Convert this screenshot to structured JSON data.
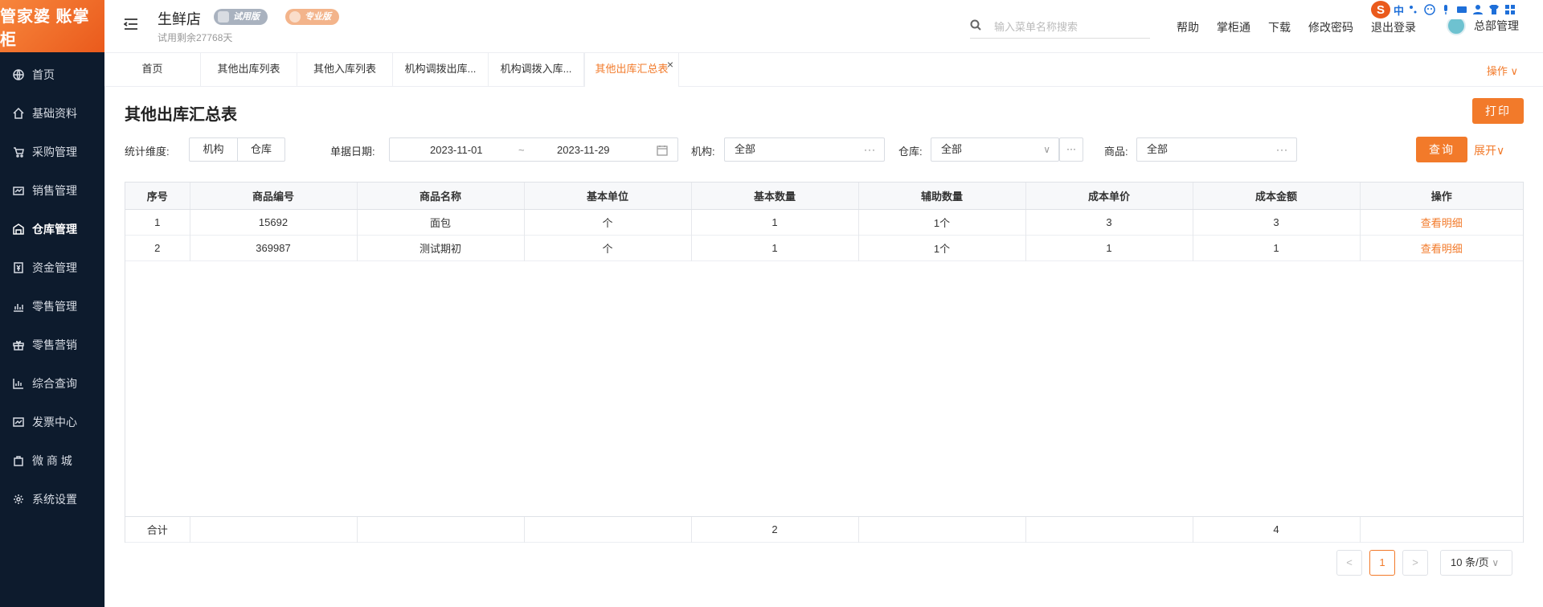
{
  "brand": {
    "logo_text": "管家婆 账掌柜"
  },
  "sidebar": {
    "items": [
      {
        "label": "首页",
        "icon": "globe-icon"
      },
      {
        "label": "基础资料",
        "icon": "home-icon"
      },
      {
        "label": "采购管理",
        "icon": "cart-icon"
      },
      {
        "label": "销售管理",
        "icon": "sales-icon"
      },
      {
        "label": "仓库管理",
        "icon": "warehouse-icon",
        "active": true
      },
      {
        "label": "资金管理",
        "icon": "money-icon"
      },
      {
        "label": "零售管理",
        "icon": "chart-icon"
      },
      {
        "label": "零售营销",
        "icon": "gift-icon"
      },
      {
        "label": "综合查询",
        "icon": "bar-chart-icon"
      },
      {
        "label": "发票中心",
        "icon": "invoice-icon"
      },
      {
        "label": "微 商 城",
        "icon": "bag-icon"
      },
      {
        "label": "系统设置",
        "icon": "gear-icon"
      }
    ]
  },
  "header": {
    "store_name": "生鲜店",
    "badge_trial": "试用版",
    "badge_pro": "专业版",
    "trial_days": "试用剩余27768天",
    "search_placeholder": "输入菜单名称搜索",
    "links": [
      "帮助",
      "掌柜通",
      "下载",
      "修改密码",
      "退出登录"
    ],
    "user_name": "总部管理",
    "ime_label": "中"
  },
  "tabs": {
    "items": [
      "首页",
      "其他出库列表",
      "其他入库列表",
      "机构调拨出库...",
      "机构调拨入库...",
      "其他出库汇总表"
    ],
    "close_glyph": "×",
    "ops_label": "操作 ∨"
  },
  "page": {
    "title": "其他出库汇总表",
    "print_label": "打印",
    "filters": {
      "dim_label": "统计维度:",
      "dim_options": [
        "机构",
        "仓库"
      ],
      "date_label": "单据日期:",
      "date_from": "2023-11-01",
      "date_sep": "~",
      "date_to": "2023-11-29",
      "org_label": "机构:",
      "org_value": "全部",
      "wh_label": "仓库:",
      "wh_value": "全部",
      "product_label": "商品:",
      "product_value": "全部",
      "more_glyph": "···",
      "query_label": "查询",
      "expand_label": "展开∨"
    }
  },
  "table": {
    "columns": [
      "序号",
      "商品编号",
      "商品名称",
      "基本单位",
      "基本数量",
      "辅助数量",
      "成本单价",
      "成本金额",
      "操作"
    ],
    "rows": [
      [
        "1",
        "15692",
        "面包",
        "个",
        "1",
        "1个",
        "3",
        "3",
        "查看明细"
      ],
      [
        "2",
        "369987",
        "测试期初",
        "个",
        "1",
        "1个",
        "1",
        "1",
        "查看明细"
      ]
    ],
    "footer": [
      "合计",
      "",
      "",
      "",
      "2",
      "",
      "",
      "4",
      ""
    ]
  },
  "pagination": {
    "prev": "<",
    "current": "1",
    "next": ">",
    "page_size": "10 条/页"
  },
  "colors": {
    "accent": "#f27a2a",
    "sidebar_bg": "#0d1b2d"
  }
}
